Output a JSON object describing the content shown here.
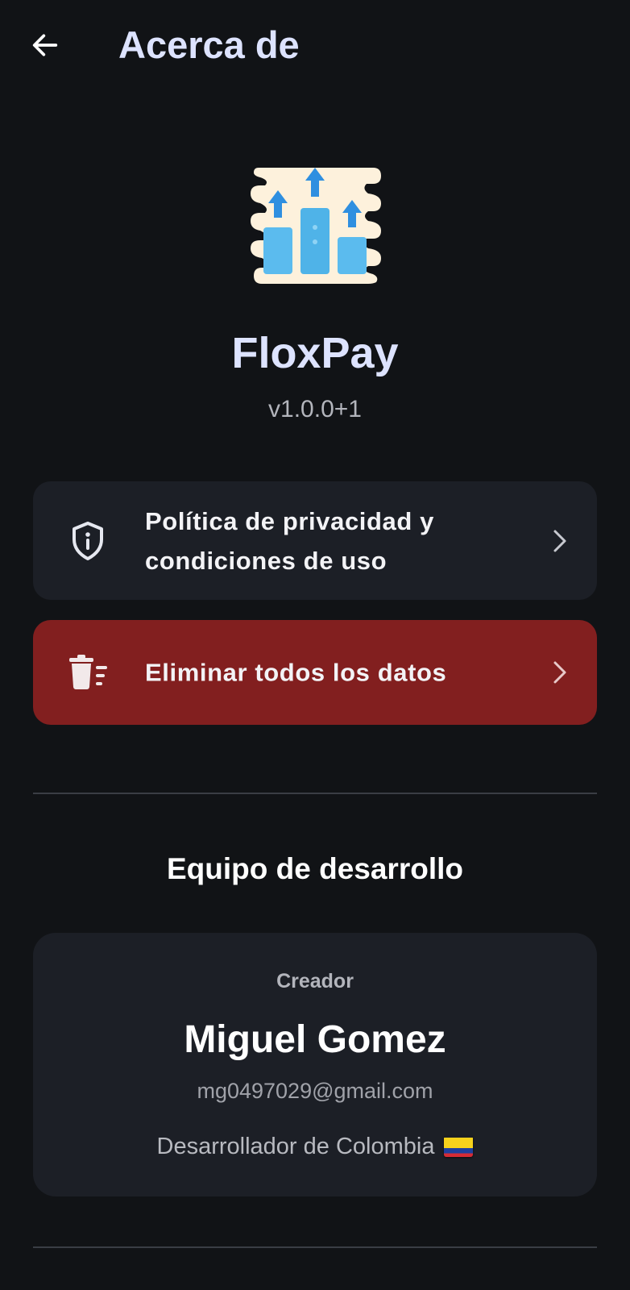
{
  "header": {
    "title": "Acerca de",
    "back_icon": "arrow-left-icon"
  },
  "app": {
    "logo_icon": "growth-chart-arrows-icon",
    "name": "FloxPay",
    "version": "v1.0.0+1"
  },
  "menu": {
    "privacy": {
      "label": "Política de privacidad y condiciones de uso",
      "icon": "shield-info-icon",
      "chevron": "chevron-right-icon",
      "color": "#1c1f26"
    },
    "delete": {
      "label": "Eliminar todos los datos",
      "icon": "trash-list-icon",
      "chevron": "chevron-right-icon",
      "color": "#821f1f"
    }
  },
  "team": {
    "section_title": "Equipo de desarrollo",
    "member": {
      "role": "Creador",
      "name": "Miguel Gomez",
      "email": "mg0497029@gmail.com",
      "origin": "Desarrollador de Colombia",
      "flag": "colombia-flag-icon"
    }
  },
  "colors": {
    "background": "#111316",
    "accent_text": "#dde3ff",
    "card": "#1c1f26",
    "danger": "#821f1f"
  }
}
